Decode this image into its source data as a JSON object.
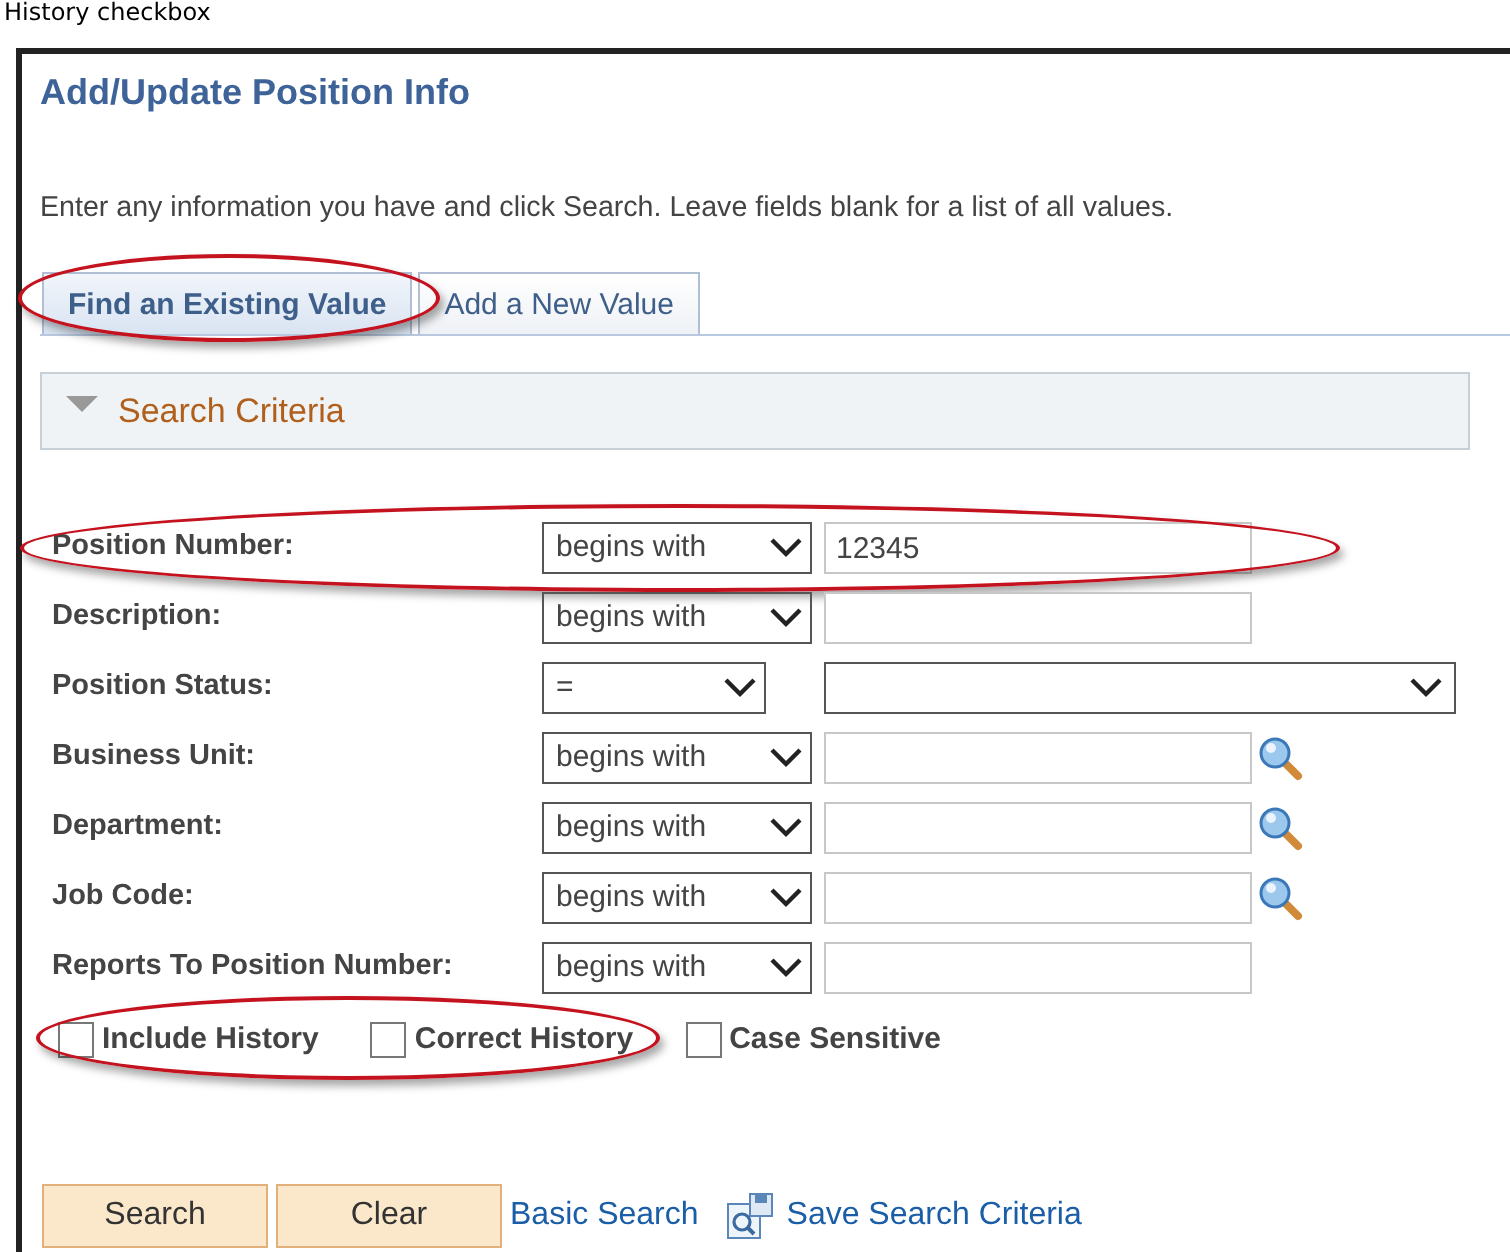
{
  "caption": "History checkbox",
  "title": "Add/Update Position Info",
  "instructions": "Enter any information you have and click Search. Leave fields blank for a list of all values.",
  "tabs": [
    {
      "label": "Find an Existing Value",
      "selected": true,
      "highlighted": true
    },
    {
      "label": "Add a New Value",
      "selected": false,
      "highlighted": false
    }
  ],
  "section": {
    "label": "Search Criteria",
    "expanded": true
  },
  "fields": [
    {
      "label": "Position Number:",
      "operator": "begins with",
      "value": "12345",
      "kind": "text",
      "lookup": false,
      "highlighted": true
    },
    {
      "label": "Description:",
      "operator": "begins with",
      "kind": "text",
      "lookup": false,
      "highlighted": false
    },
    {
      "label": "Position Status:",
      "operator": "=",
      "kind": "select",
      "lookup": false,
      "highlighted": false
    },
    {
      "label": "Business Unit:",
      "operator": "begins with",
      "kind": "text",
      "lookup": true,
      "highlighted": false
    },
    {
      "label": "Department:",
      "operator": "begins with",
      "kind": "text",
      "lookup": true,
      "highlighted": false
    },
    {
      "label": "Job Code:",
      "operator": "begins with",
      "kind": "text",
      "lookup": true,
      "highlighted": false
    },
    {
      "label": "Reports To Position Number:",
      "operator": "begins with",
      "kind": "text",
      "lookup": false,
      "highlighted": false
    }
  ],
  "options": [
    {
      "label": "Include History",
      "checked": false,
      "highlighted": true
    },
    {
      "label": "Correct History",
      "checked": false,
      "highlighted": true
    },
    {
      "label": "Case Sensitive",
      "checked": false,
      "highlighted": false
    }
  ],
  "buttons": [
    "Search",
    "Clear"
  ],
  "links": [
    {
      "label": "Basic Search",
      "kind": "plain"
    },
    {
      "label": "Save Search Criteria",
      "kind": "save"
    }
  ]
}
